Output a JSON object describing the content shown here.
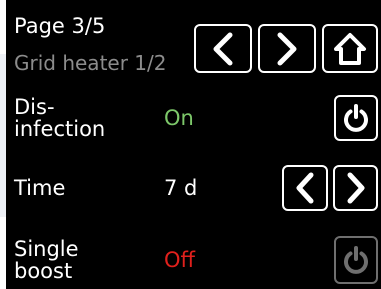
{
  "header": {
    "page": "Page 3/5",
    "subtitle": "Grid heater 1/2",
    "buttons": [
      {
        "name": "previous-page-button",
        "icon": "chevron-left-icon"
      },
      {
        "name": "next-page-button",
        "icon": "chevron-right-icon"
      },
      {
        "name": "home-button",
        "icon": "home-icon"
      }
    ]
  },
  "rows": [
    {
      "label": "Dis-\ninfection",
      "value": "On",
      "value_color": "#7dc86a",
      "control": "power-toggle",
      "enabled": true
    },
    {
      "label": "Time",
      "value": "7 d",
      "value_color": "#ffffff",
      "control": "stepper"
    },
    {
      "label": "Single\nboost",
      "value": "Off",
      "value_color": "#e0201c",
      "control": "power-toggle",
      "enabled": false
    }
  ],
  "colors": {
    "background": "#000000",
    "text": "#ffffff",
    "subtitle": "#8c8c8c",
    "on": "#7dc86a",
    "off": "#e0201c",
    "disabled_control": "#6f6f6f"
  }
}
